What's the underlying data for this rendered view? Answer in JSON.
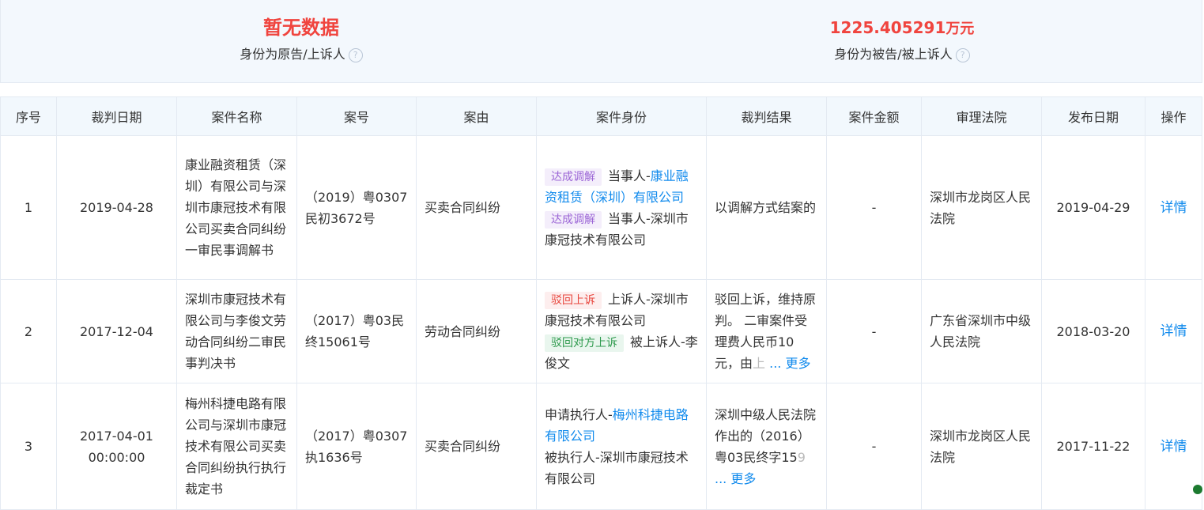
{
  "summary": {
    "plaintiff": {
      "value": "暂无数据",
      "label": "身份为原告/上诉人",
      "help_icon": "question-circle-icon"
    },
    "defendant": {
      "value": "1225.405291",
      "unit": "万元",
      "label": "身份为被告/被上诉人",
      "help_icon": "question-circle-icon"
    }
  },
  "table": {
    "headers": [
      "序号",
      "裁判日期",
      "案件名称",
      "案号",
      "案由",
      "案件身份",
      "裁判结果",
      "案件金额",
      "审理法院",
      "发布日期",
      "操作"
    ],
    "rows": [
      {
        "index": "1",
        "judge_date": "2019-04-28",
        "case_name": "康业融资租赁（深圳）有限公司与深圳市康冠技术有限公司买卖合同纠纷一审民事调解书",
        "case_no": "（2019）粤0307民初3672号",
        "cause": "买卖合同纠纷",
        "parties": [
          {
            "tag": "达成调解",
            "role": "当事人-",
            "name": "康业融资租赁（深圳）有限公司"
          },
          {
            "tag": "达成调解",
            "role": "当事人-深圳市康冠技术有限公司",
            "name": ""
          }
        ],
        "result": "以调解方式结案的",
        "amount": "-",
        "court": "深圳市龙岗区人民法院",
        "publish_date": "2019-04-29",
        "action": "详情"
      },
      {
        "index": "2",
        "judge_date": "2017-12-04",
        "case_name": "深圳市康冠技术有限公司与李俊文劳动合同纠纷二审民事判决书",
        "case_no": "（2017）粤03民终15061号",
        "cause": "劳动合同纠纷",
        "parties": [
          {
            "tag": "驳回上诉",
            "role": "上诉人-深圳市康冠技术有限公司",
            "name": ""
          },
          {
            "tag": "驳回对方上诉",
            "role": "被上诉人-李俊文",
            "name": ""
          }
        ],
        "result": "驳回上诉，维持原判。 二审案件受理费人民币10元，由",
        "result_faded": "上",
        "more": "... 更多",
        "amount": "-",
        "court": "广东省深圳市中级人民法院",
        "publish_date": "2018-03-20",
        "action": "详情"
      },
      {
        "index": "3",
        "judge_date": "2017-04-01 00:00:00",
        "case_name": "梅州科捷电路有限公司与深圳市康冠技术有限公司买卖合同纠纷执行执行裁定书",
        "case_no": "（2017）粤0307执1636号",
        "cause": "买卖合同纠纷",
        "parties": [
          {
            "tag": "",
            "role": "申请执行人-",
            "name": "梅州科捷电路有限公司"
          },
          {
            "tag": "",
            "role": "被执行人-深圳市康冠技术有限公司",
            "name": ""
          }
        ],
        "result": "深圳中级人民法院作出的（2016）粤03民终字15",
        "result_faded": "9",
        "more": "... 更多",
        "amount": "-",
        "court": "深圳市龙岗区人民法院",
        "publish_date": "2017-11-22",
        "action": "详情"
      }
    ]
  },
  "colors": {
    "accent": "#128bed",
    "highlight": "#f0443e",
    "header_bg": "#f2f8fd"
  }
}
